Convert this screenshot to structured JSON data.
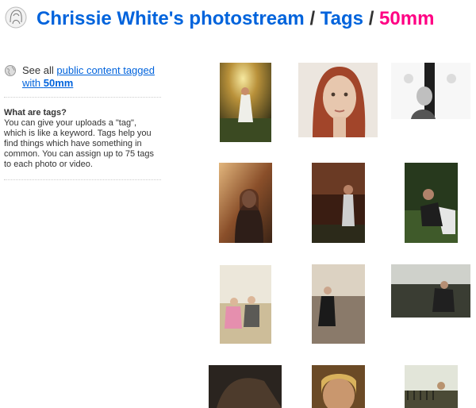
{
  "header": {
    "owner_link": "Chrissie White's photostream",
    "separator1": "/",
    "tags_link": "Tags",
    "separator2": "/",
    "tag_name": "50mm"
  },
  "sidebar": {
    "see_all_prefix": "See all",
    "see_all_link_text": "public content tagged with",
    "see_all_tag": "50mm",
    "help_title": "What are tags?",
    "help_text": "You can give your uploads a \"tag\", which is like a keyword. Tags help you find things which have something in common. You can assign up to 75 tags to each photo or video."
  },
  "photos": [
    {
      "subject": "girl in white dress, sunlit forest"
    },
    {
      "subject": "portrait, red hair, pale background"
    },
    {
      "subject": "woman behind tree, black and white"
    },
    {
      "subject": "smiling woman, autumn light"
    },
    {
      "subject": "woman standing, dark trees"
    },
    {
      "subject": "woman sitting on chair, green field"
    },
    {
      "subject": "two children on beach"
    },
    {
      "subject": "woman in black dress, rocky shore"
    },
    {
      "subject": "woman crouching, dark shoreline"
    },
    {
      "subject": "woman lying in grass"
    },
    {
      "subject": "woman portrait, warm light"
    },
    {
      "subject": "woman near fence, trees"
    }
  ],
  "icons": {
    "buddy": "user-avatar-icon",
    "globe": "globe-icon"
  },
  "colors": {
    "link": "#0063dc",
    "tag": "#ff0084",
    "text": "#333333"
  }
}
